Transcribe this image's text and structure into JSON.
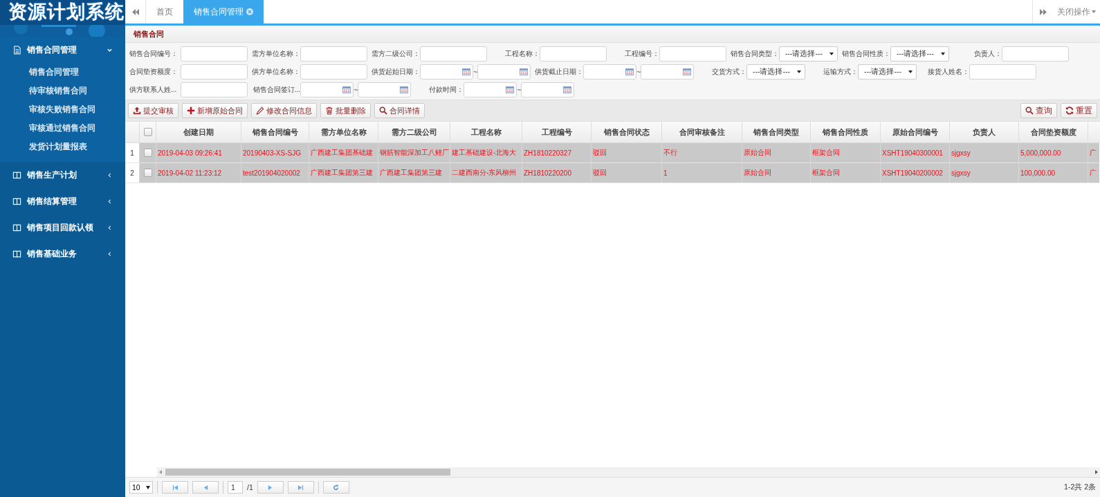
{
  "sidebar": {
    "logo": "资源计划系统",
    "groups": [
      {
        "label": "销售合同管理",
        "expanded": true,
        "children": [
          {
            "label": "销售合同管理"
          },
          {
            "label": "待审核销售合同"
          },
          {
            "label": "审核失败销售合同"
          },
          {
            "label": "审核通过销售合同"
          },
          {
            "label": "发货计划量报表"
          }
        ]
      },
      {
        "label": "销售生产计划",
        "expanded": false
      },
      {
        "label": "销售结算管理",
        "expanded": false
      },
      {
        "label": "销售项目回款认领",
        "expanded": false
      },
      {
        "label": "销售基础业务",
        "expanded": false
      }
    ]
  },
  "tabs": [
    {
      "label": "首页",
      "selected": false
    },
    {
      "label": "销售合同管理",
      "selected": true
    }
  ],
  "tab_menu": "关闭操作",
  "panel_title": "销售合同",
  "filters": [
    [
      {
        "label": "销售合同编号：",
        "kind": "text"
      },
      {
        "label": "需方单位名称：",
        "kind": "text"
      },
      {
        "label": "需方二级公司：",
        "kind": "text"
      },
      {
        "label": "工程名称：",
        "kind": "text"
      },
      {
        "label": "工程编号：",
        "kind": "text"
      },
      {
        "label": "销售合同类型：",
        "kind": "select",
        "value": "---请选择---"
      },
      {
        "label": "销售合同性质：",
        "kind": "select",
        "value": "---请选择---"
      },
      {
        "label": "负责人：",
        "kind": "text"
      }
    ],
    [
      {
        "label": "合同垫资额度：",
        "kind": "text"
      },
      {
        "label": "供方单位名称：",
        "kind": "text"
      },
      {
        "label": "供货起始日期：",
        "kind": "daterange",
        "separator": "~"
      },
      {
        "label": "供货截止日期：",
        "kind": "daterange",
        "separator": "~"
      },
      {
        "label": "交货方式：",
        "kind": "select",
        "value": "---请选择---"
      },
      {
        "label": "运输方式：",
        "kind": "select",
        "value": "---请选择---"
      },
      {
        "label": "接货人姓名：",
        "kind": "text"
      }
    ],
    [
      {
        "label": "供方联系人姓...",
        "kind": "text"
      },
      {
        "label": "销售合同签订...",
        "kind": "daterange",
        "separator": "~"
      },
      {
        "label": "付款时间：",
        "kind": "daterange",
        "separator": "~"
      }
    ]
  ],
  "toolbar": [
    {
      "label": "提交审核"
    },
    {
      "label": "新增原始合同"
    },
    {
      "label": "修改合同信息"
    },
    {
      "label": "批量删除"
    },
    {
      "label": "合同详情"
    }
  ],
  "search_buttons": [
    {
      "label": "查询"
    },
    {
      "label": "重置"
    }
  ],
  "table": {
    "select_all_checked": false,
    "columns": [
      "创建日期",
      "销售合同编号",
      "需方单位名称",
      "需方二级公司",
      "工程名称",
      "工程编号",
      "销售合同状态",
      "合同审核备注",
      "销售合同类型",
      "销售合同性质",
      "原始合同编号",
      "负责人",
      "合同垫资额度"
    ],
    "rows": [
      {
        "number": "1",
        "checked": false,
        "cells": [
          "2019-04-03 09:26:41",
          "20190403-XS-SJG",
          "广西建工集团基础建",
          "钢筋智能深加工八鲤厂",
          "建工基础建设-北海大",
          "ZH1810220327",
          "驳回",
          "不行",
          "原始合同",
          "框架合同",
          "XSHT19040300001",
          "sjgxsy",
          "5,000,000.00",
          "广"
        ]
      },
      {
        "number": "2",
        "checked": false,
        "cells": [
          "2019-04-02 11:23:12",
          "test201904020002",
          "广西建工集团第三建",
          "广西建工集团第三建",
          "二建西南分-东风柳州",
          "ZH1810220200",
          "驳回",
          "1",
          "原始合同",
          "框架合同",
          "XSHT19040200002",
          "sjgxsy",
          "100,000.00",
          "广"
        ]
      }
    ]
  },
  "pager": {
    "page_size": "10",
    "page": "1",
    "total_pages": "/1",
    "summary": "1-2共 2条"
  }
}
